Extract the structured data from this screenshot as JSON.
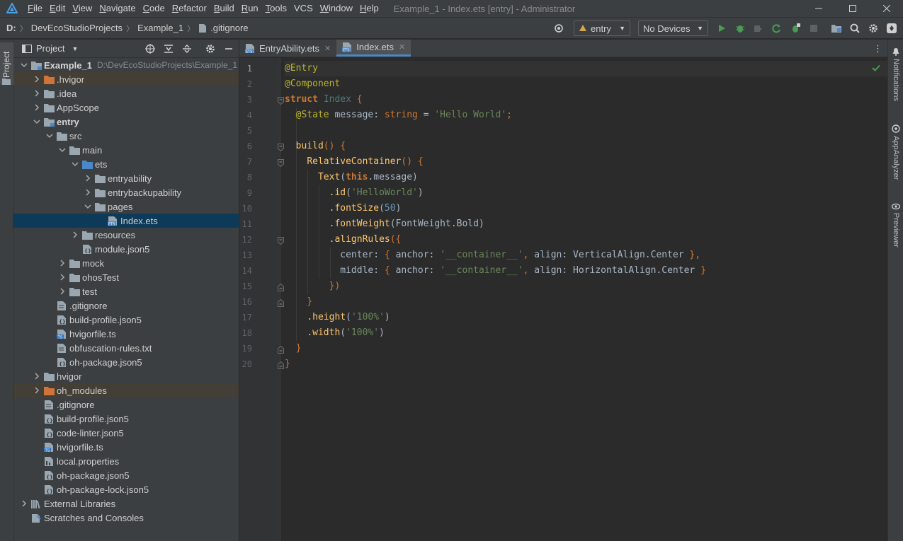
{
  "window": {
    "title": "Example_1 - Index.ets [entry] - Administrator",
    "menus": [
      {
        "underline": "F",
        "rest": "ile"
      },
      {
        "underline": "E",
        "rest": "dit"
      },
      {
        "underline": "V",
        "rest": "iew"
      },
      {
        "underline": "N",
        "rest": "avigate"
      },
      {
        "underline": "C",
        "rest": "ode"
      },
      {
        "underline": "R",
        "rest": "efactor"
      },
      {
        "underline": "B",
        "rest": "uild"
      },
      {
        "underline": "R",
        "rest": "un"
      },
      {
        "underline": "T",
        "rest": "ools"
      },
      {
        "underline": "",
        "rest": "VCS"
      },
      {
        "underline": "W",
        "rest": "indow"
      },
      {
        "underline": "H",
        "rest": "elp"
      }
    ]
  },
  "breadcrumb": [
    "D:",
    "DevEcoStudioProjects",
    "Example_1",
    ".gitignore"
  ],
  "toolbar": {
    "module_combo": "entry",
    "device_combo": "No Devices"
  },
  "left_strip": {
    "project_tab": "Project"
  },
  "project_panel": {
    "title": "Project",
    "tree": [
      {
        "name": "Example_1",
        "path": "D:\\DevEcoStudioProjects\\Example_1",
        "depth": 0,
        "arrow": "open",
        "icon": "folder-module",
        "bold": true
      },
      {
        "name": ".hvigor",
        "depth": 1,
        "arrow": "closed",
        "icon": "folder-orange",
        "highlight": true
      },
      {
        "name": ".idea",
        "depth": 1,
        "arrow": "closed",
        "icon": "folder"
      },
      {
        "name": "AppScope",
        "depth": 1,
        "arrow": "closed",
        "icon": "folder"
      },
      {
        "name": "entry",
        "depth": 1,
        "arrow": "open",
        "icon": "folder-module",
        "bold": true
      },
      {
        "name": "src",
        "depth": 2,
        "arrow": "open",
        "icon": "folder"
      },
      {
        "name": "main",
        "depth": 3,
        "arrow": "open",
        "icon": "folder"
      },
      {
        "name": "ets",
        "depth": 4,
        "arrow": "open",
        "icon": "folder-blue"
      },
      {
        "name": "entryability",
        "depth": 5,
        "arrow": "closed",
        "icon": "folder"
      },
      {
        "name": "entrybackupability",
        "depth": 5,
        "arrow": "closed",
        "icon": "folder"
      },
      {
        "name": "pages",
        "depth": 5,
        "arrow": "open",
        "icon": "folder"
      },
      {
        "name": "Index.ets",
        "depth": 6,
        "arrow": "none",
        "icon": "file-ets",
        "selected": true
      },
      {
        "name": "resources",
        "depth": 4,
        "arrow": "closed",
        "icon": "folder"
      },
      {
        "name": "module.json5",
        "depth": 4,
        "arrow": "none",
        "icon": "file-json"
      },
      {
        "name": "mock",
        "depth": 3,
        "arrow": "closed",
        "icon": "folder"
      },
      {
        "name": "ohosTest",
        "depth": 3,
        "arrow": "closed",
        "icon": "folder"
      },
      {
        "name": "test",
        "depth": 3,
        "arrow": "closed",
        "icon": "folder"
      },
      {
        "name": ".gitignore",
        "depth": 2,
        "arrow": "none",
        "icon": "file-text"
      },
      {
        "name": "build-profile.json5",
        "depth": 2,
        "arrow": "none",
        "icon": "file-json"
      },
      {
        "name": "hvigorfile.ts",
        "depth": 2,
        "arrow": "none",
        "icon": "file-ts"
      },
      {
        "name": "obfuscation-rules.txt",
        "depth": 2,
        "arrow": "none",
        "icon": "file-text"
      },
      {
        "name": "oh-package.json5",
        "depth": 2,
        "arrow": "none",
        "icon": "file-json"
      },
      {
        "name": "hvigor",
        "depth": 1,
        "arrow": "closed",
        "icon": "folder"
      },
      {
        "name": "oh_modules",
        "depth": 1,
        "arrow": "closed",
        "icon": "folder-orange",
        "highlight": true
      },
      {
        "name": ".gitignore",
        "depth": 1,
        "arrow": "none",
        "icon": "file-text"
      },
      {
        "name": "build-profile.json5",
        "depth": 1,
        "arrow": "none",
        "icon": "file-json"
      },
      {
        "name": "code-linter.json5",
        "depth": 1,
        "arrow": "none",
        "icon": "file-json"
      },
      {
        "name": "hvigorfile.ts",
        "depth": 1,
        "arrow": "none",
        "icon": "file-ts"
      },
      {
        "name": "local.properties",
        "depth": 1,
        "arrow": "none",
        "icon": "file-props"
      },
      {
        "name": "oh-package.json5",
        "depth": 1,
        "arrow": "none",
        "icon": "file-json"
      },
      {
        "name": "oh-package-lock.json5",
        "depth": 1,
        "arrow": "none",
        "icon": "file-json"
      },
      {
        "name": "External Libraries",
        "depth": 0,
        "arrow": "closed",
        "icon": "libraries"
      },
      {
        "name": "Scratches and Consoles",
        "depth": 0,
        "arrow": "none",
        "icon": "scratches"
      }
    ]
  },
  "editor": {
    "tabs": [
      {
        "label": "EntryAbility.ets",
        "active": false
      },
      {
        "label": "Index.ets",
        "active": true
      }
    ],
    "lines": [
      [
        [
          "@Entry",
          "dec"
        ]
      ],
      [
        [
          "@Component",
          "dec"
        ]
      ],
      [
        [
          "struct ",
          "kwb"
        ],
        [
          "Index ",
          "cls"
        ],
        [
          "{",
          "punc"
        ]
      ],
      [
        [
          "  ",
          ""
        ],
        [
          "@State ",
          "dec"
        ],
        [
          "message",
          ""
        ],
        [
          ": ",
          ""
        ],
        [
          "string ",
          "kw"
        ],
        [
          "= ",
          ""
        ],
        [
          "'Hello World'",
          "str"
        ],
        [
          ";",
          "punc"
        ]
      ],
      [
        [
          "",
          ""
        ]
      ],
      [
        [
          "  ",
          ""
        ],
        [
          "build",
          "fn"
        ],
        [
          "() ",
          "punc"
        ],
        [
          "{",
          "punc"
        ]
      ],
      [
        [
          "    ",
          ""
        ],
        [
          "RelativeContainer",
          "fn"
        ],
        [
          "() ",
          "punc"
        ],
        [
          "{",
          "punc"
        ]
      ],
      [
        [
          "      ",
          ""
        ],
        [
          "Text",
          "fn"
        ],
        [
          "(",
          ""
        ],
        [
          "this",
          "kwb"
        ],
        [
          ".message",
          ""
        ],
        [
          ")",
          ""
        ]
      ],
      [
        [
          "        ",
          ""
        ],
        [
          ".id",
          "fn"
        ],
        [
          "(",
          ""
        ],
        [
          "'HelloWorld'",
          "str"
        ],
        [
          ")",
          ""
        ]
      ],
      [
        [
          "        ",
          ""
        ],
        [
          ".fontSize",
          "fn"
        ],
        [
          "(",
          ""
        ],
        [
          "50",
          "num"
        ],
        [
          ")",
          ""
        ]
      ],
      [
        [
          "        ",
          ""
        ],
        [
          ".fontWeight",
          "fn"
        ],
        [
          "(",
          ""
        ],
        [
          "FontWeight.Bold",
          ""
        ],
        [
          ")",
          ""
        ]
      ],
      [
        [
          "        ",
          ""
        ],
        [
          ".alignRules",
          "fn"
        ],
        [
          "({",
          "punc"
        ]
      ],
      [
        [
          "          ",
          ""
        ],
        [
          "center",
          ""
        ],
        [
          ": ",
          ""
        ],
        [
          "{ ",
          "punc"
        ],
        [
          "anchor",
          ""
        ],
        [
          ": ",
          ""
        ],
        [
          "'__container__'",
          "str"
        ],
        [
          ", ",
          "punc"
        ],
        [
          "align",
          ""
        ],
        [
          ": ",
          ""
        ],
        [
          "VerticalAlign.Center ",
          ""
        ],
        [
          "}",
          "punc"
        ],
        [
          ",",
          "punc"
        ]
      ],
      [
        [
          "          ",
          ""
        ],
        [
          "middle",
          ""
        ],
        [
          ": ",
          ""
        ],
        [
          "{ ",
          "punc"
        ],
        [
          "anchor",
          ""
        ],
        [
          ": ",
          ""
        ],
        [
          "'__container__'",
          "str"
        ],
        [
          ", ",
          "punc"
        ],
        [
          "align",
          ""
        ],
        [
          ": ",
          ""
        ],
        [
          "HorizontalAlign.Center ",
          ""
        ],
        [
          "}",
          "punc"
        ]
      ],
      [
        [
          "        ",
          ""
        ],
        [
          "})",
          "punc"
        ]
      ],
      [
        [
          "    ",
          ""
        ],
        [
          "}",
          "punc"
        ]
      ],
      [
        [
          "    ",
          ""
        ],
        [
          ".height",
          "fn"
        ],
        [
          "(",
          ""
        ],
        [
          "'100%'",
          "str"
        ],
        [
          ")",
          ""
        ]
      ],
      [
        [
          "    ",
          ""
        ],
        [
          ".width",
          "fn"
        ],
        [
          "(",
          ""
        ],
        [
          "'100%'",
          "str"
        ],
        [
          ")",
          ""
        ]
      ],
      [
        [
          "  ",
          ""
        ],
        [
          "}",
          "punc"
        ]
      ],
      [
        [
          "}",
          "punc"
        ]
      ]
    ]
  },
  "right_strip": [
    "Notifications",
    "AppAnalyzer",
    "Previewer"
  ],
  "colors": {
    "accent": "#4a88c7",
    "selection": "#0d3a58",
    "excluded_folder_bg": "#433f37",
    "run_green": "#499c54"
  }
}
